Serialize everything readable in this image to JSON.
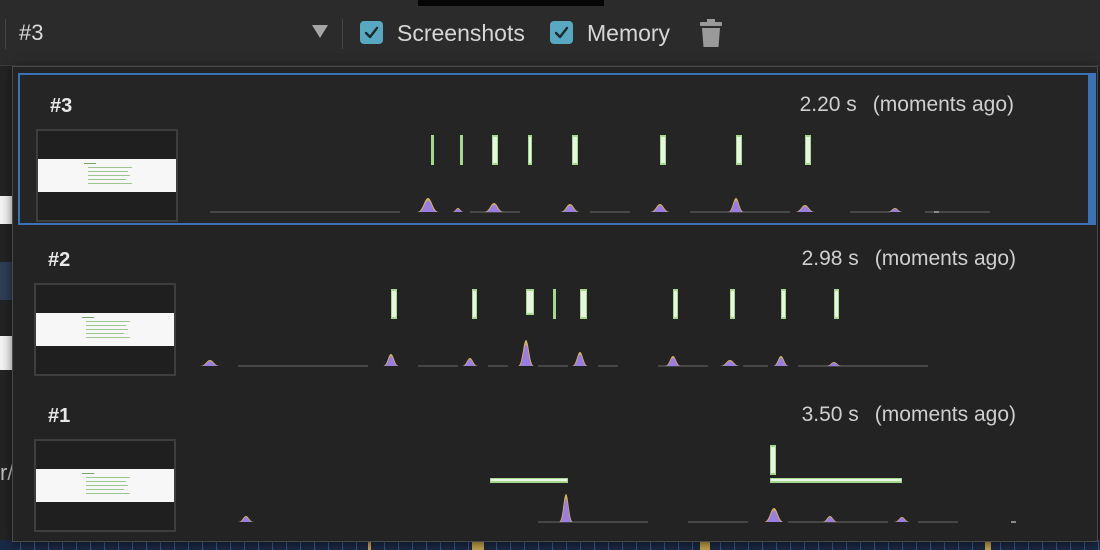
{
  "toolbar": {
    "recording_select": "#3",
    "screenshots_label": "Screenshots",
    "screenshots_checked": true,
    "memory_label": "Memory",
    "memory_checked": true,
    "clear_icon": "trash-icon",
    "checkbox_color": "#59a8c2"
  },
  "recordings": [
    {
      "id": "#3",
      "duration": "2.20 s",
      "when": "(moments ago)",
      "selected": true
    },
    {
      "id": "#2",
      "duration": "2.98 s",
      "when": "(moments ago)",
      "selected": false
    },
    {
      "id": "#1",
      "duration": "3.50 s",
      "when": "(moments ago)",
      "selected": false
    }
  ],
  "colors": {
    "selection": "#3a72b8",
    "frame_marker": "#a5d88f",
    "cpu_scripting": "#9a7de0",
    "cpu_rendering": "#d8b86a"
  }
}
